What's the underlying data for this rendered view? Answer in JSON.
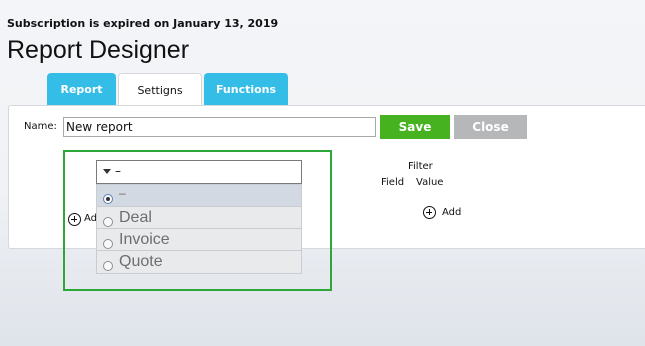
{
  "notice": "Subscription is expired on January 13, 2019",
  "page_title": "Report Designer",
  "tabs": [
    {
      "label": "Report",
      "state": "blue"
    },
    {
      "label": "Settigns",
      "state": "selected"
    },
    {
      "label": "Functions",
      "state": "blue"
    }
  ],
  "name_field": {
    "label": "Name:",
    "value": "New report"
  },
  "buttons": {
    "save": "Save",
    "close": "Close"
  },
  "colors": {
    "save": "#46b21f",
    "close": "#b6b7b8",
    "tab_blue": "#34bde7",
    "highlight_box": "#2ca83a"
  },
  "dropdown": {
    "selected": "–",
    "options": [
      {
        "label": "–",
        "checked": true
      },
      {
        "label": "Deal",
        "checked": false
      },
      {
        "label": "Invoice",
        "checked": false
      },
      {
        "label": "Quote",
        "checked": false
      }
    ]
  },
  "add_left": "Ad",
  "filter_header": {
    "filter": "Filter",
    "field": "Field",
    "value": "Value"
  },
  "add_right": "Add"
}
